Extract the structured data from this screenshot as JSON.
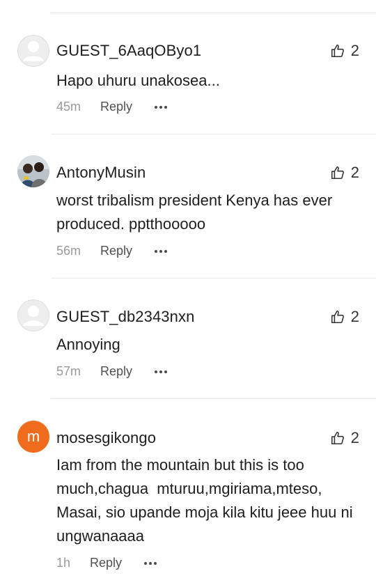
{
  "comments": [
    {
      "username": "GUEST_6AaqOByo1",
      "avatar": "default-user-icon",
      "likes": "2",
      "text": "Hapo uhuru unakosea...",
      "time": "45m",
      "reply_label": "Reply"
    },
    {
      "username": "AntonyMusin",
      "avatar": "photo",
      "likes": "2",
      "text": "worst tribalism president Kenya has ever produced. pptthooooo",
      "time": "56m",
      "reply_label": "Reply"
    },
    {
      "username": "GUEST_db2343nxn",
      "avatar": "default-user-icon",
      "likes": "2",
      "text": "Annoying",
      "time": "57m",
      "reply_label": "Reply"
    },
    {
      "username": "mosesgikongo",
      "avatar_letter": "m",
      "avatar_color": "#ef6c1d",
      "likes": "2",
      "text": "Iam from the mountain but this is too much,chagua  mturuu,mgiriama,mteso, Masai, sio upande moja kila kitu jeee huu ni ungwanaaaa",
      "time": "1h",
      "reply_label": "Reply"
    }
  ],
  "icons": {
    "like": "thumbs-up-outline-icon",
    "more": "more-dots-icon"
  }
}
